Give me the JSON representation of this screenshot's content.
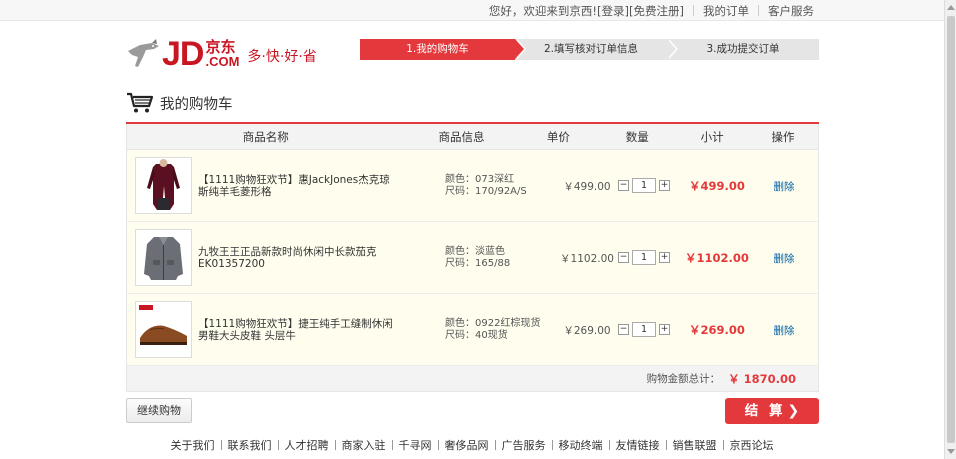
{
  "topbar": {
    "greeting": "您好，欢迎来到京西!",
    "login": "[登录]",
    "register": "[免费注册]",
    "my_orders": "我的订单",
    "customer_service": "客户服务"
  },
  "logo": {
    "brand": "JD",
    "cn": "京东",
    "com": ".COM",
    "slogan": "多·快·好·省"
  },
  "steps": [
    {
      "label": "1.我的购物车",
      "active": true
    },
    {
      "label": "2.填写核对订单信息",
      "active": false
    },
    {
      "label": "3.成功提交订单",
      "active": false
    }
  ],
  "cart": {
    "title": "我的购物车",
    "headers": {
      "name": "商品名称",
      "info": "商品信息",
      "price": "单价",
      "qty": "数量",
      "subtotal": "小计",
      "op": "操作"
    },
    "items": [
      {
        "name": "【1111购物狂欢节】惠JackJones杰克琼斯纯羊毛菱形格",
        "color": "颜色：073深红",
        "size": "尺码：170/92A/S",
        "price": "￥499.00",
        "qty": "1",
        "subtotal": "￥499.00",
        "delete": "删除"
      },
      {
        "name": "九牧王王正品新款时尚休闲中长款茄克EK01357200",
        "color": "颜色：淡蓝色",
        "size": "尺码：165/88",
        "price": "￥1102.00",
        "qty": "1",
        "subtotal": "￥1102.00",
        "delete": "删除"
      },
      {
        "name": "【1111购物狂欢节】捷王纯手工缝制休闲男鞋大头皮鞋 头层牛",
        "color": "颜色：0922红棕现货",
        "size": "尺码：40现货",
        "price": "￥269.00",
        "qty": "1",
        "subtotal": "￥269.00",
        "delete": "删除"
      }
    ],
    "qty_minus": "−",
    "qty_plus": "+",
    "total_label": "购物金额总计：",
    "total_amount": "￥ 1870.00"
  },
  "actions": {
    "continue": "继续购物",
    "checkout": "结 算",
    "checkout_icon": "chevron-right-icon"
  },
  "footer": {
    "links": [
      "关于我们",
      "联系我们",
      "人才招聘",
      "商家入驻",
      "千寻网",
      "奢侈品网",
      "广告服务",
      "移动终端",
      "友情链接",
      "销售联盟",
      "京西论坛"
    ]
  },
  "colors": {
    "accent": "#e4393c",
    "link": "#005ea7",
    "row_bg": "#fffded"
  }
}
